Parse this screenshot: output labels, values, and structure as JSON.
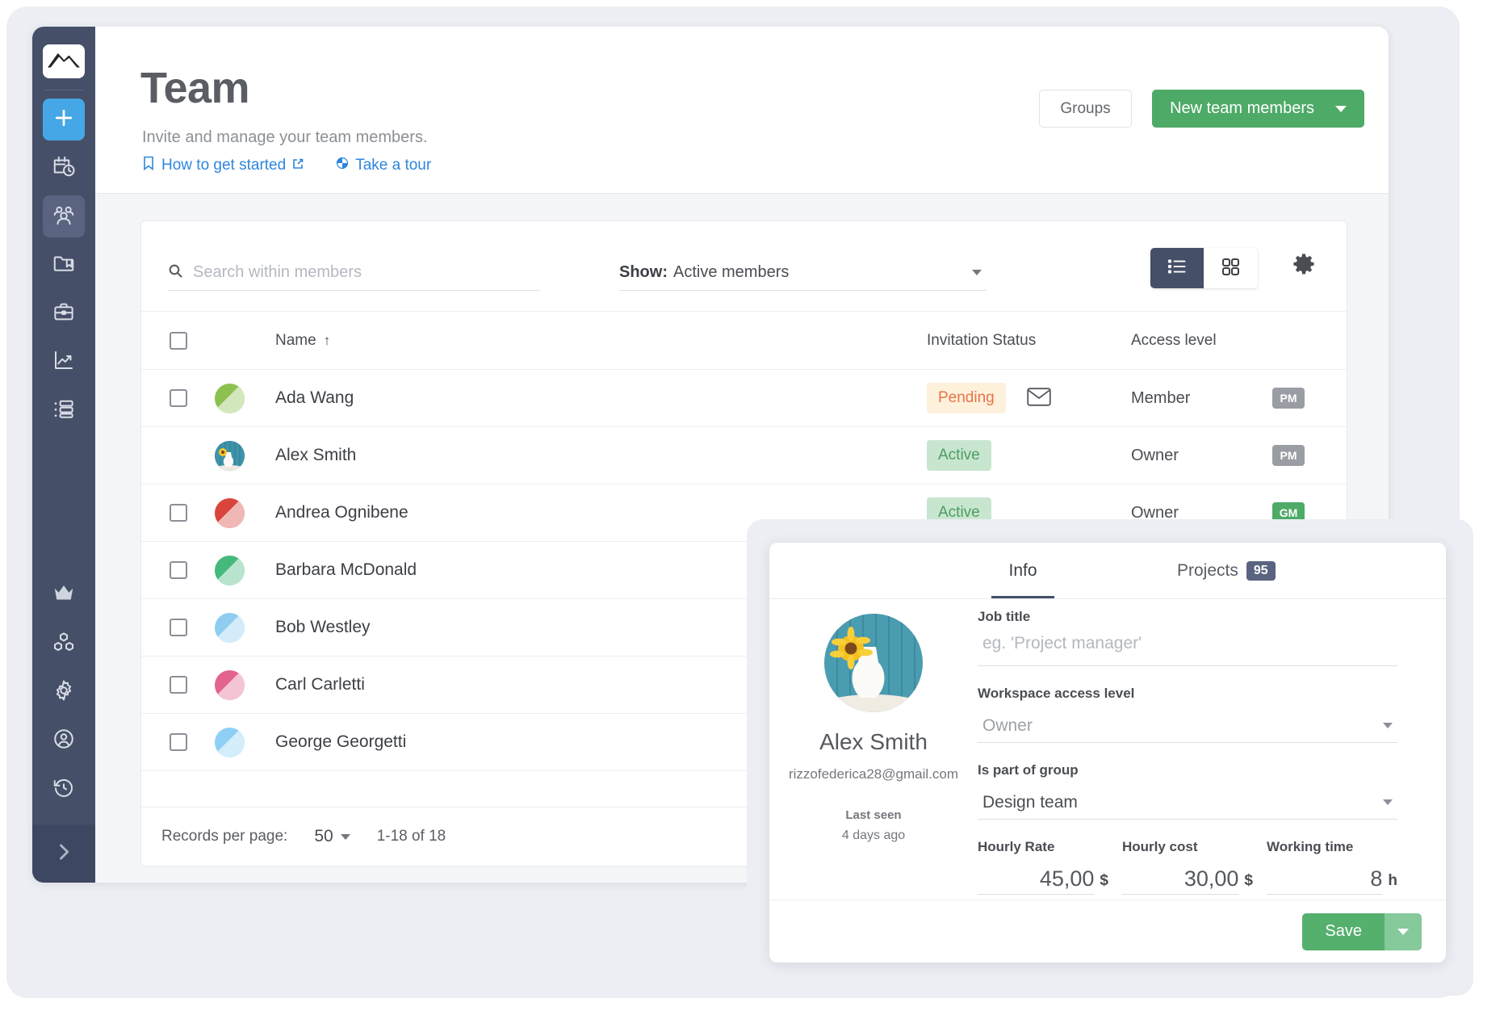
{
  "header": {
    "title": "Team",
    "subtitle": "Invite and manage your team members.",
    "links": [
      {
        "label": "How to get started",
        "icon": "bookmark-icon",
        "external": true
      },
      {
        "label": "Take a tour",
        "icon": "tour-icon",
        "external": false
      }
    ],
    "groups_button": "Groups",
    "new_members_button": "New team members"
  },
  "sidebar": {
    "items": [
      {
        "name": "logo",
        "icon": "mountain-logo-icon"
      },
      {
        "name": "add",
        "icon": "plus-icon"
      },
      {
        "name": "timesheet",
        "icon": "calendar-clock-icon"
      },
      {
        "name": "team",
        "icon": "people-icon"
      },
      {
        "name": "projects",
        "icon": "folder-bookmark-icon"
      },
      {
        "name": "clients",
        "icon": "briefcase-icon"
      },
      {
        "name": "reports",
        "icon": "chart-trend-icon"
      },
      {
        "name": "planner",
        "icon": "list-settings-icon"
      },
      {
        "name": "upgrade",
        "icon": "crown-icon"
      },
      {
        "name": "integrations",
        "icon": "cubes-icon"
      },
      {
        "name": "settings",
        "icon": "gear-icon"
      },
      {
        "name": "account",
        "icon": "user-circle-icon"
      },
      {
        "name": "history",
        "icon": "clock-rewind-icon"
      },
      {
        "name": "expand",
        "icon": "chevron-right-icon"
      }
    ]
  },
  "toolbar": {
    "search_placeholder": "Search within members",
    "search_value": "",
    "show_label": "Show:",
    "show_value": "Active members",
    "view_list_icon": "list-view-icon",
    "view_grid_icon": "grid-view-icon",
    "settings_icon": "gear-icon"
  },
  "table": {
    "columns": [
      "",
      "",
      "Name",
      "Invitation Status",
      "Access level",
      ""
    ],
    "sort_column": "Name",
    "sort_direction": "↑",
    "rows": [
      {
        "name": "Ada Wang",
        "checkbox": true,
        "status": "Pending",
        "status_kind": "pending",
        "mail_icon": true,
        "access": "Member",
        "role_badge": "PM",
        "role_kind": "pm",
        "avatar_color": "#8cc152",
        "avatar_kind": "color"
      },
      {
        "name": "Alex Smith",
        "checkbox": false,
        "status": "Active",
        "status_kind": "active",
        "mail_icon": false,
        "access": "Owner",
        "role_badge": "PM",
        "role_kind": "pm",
        "avatar_color": "#3d8fa6",
        "avatar_kind": "photo"
      },
      {
        "name": "Andrea Ognibene",
        "checkbox": true,
        "status": "Active",
        "status_kind": "active",
        "mail_icon": false,
        "access": "Owner",
        "role_badge": "GM",
        "role_kind": "gm",
        "avatar_color": "#d9453d",
        "avatar_kind": "color"
      },
      {
        "name": "Barbara McDonald",
        "checkbox": true,
        "status": "",
        "status_kind": "",
        "mail_icon": false,
        "access": "",
        "role_badge": "",
        "role_kind": "",
        "avatar_color": "#45b97c",
        "avatar_kind": "color"
      },
      {
        "name": "Bob Westley",
        "checkbox": true,
        "status": "",
        "status_kind": "",
        "mail_icon": false,
        "access": "",
        "role_badge": "",
        "role_kind": "",
        "avatar_color": "#8fcdf0",
        "avatar_kind": "color"
      },
      {
        "name": "Carl Carletti",
        "checkbox": true,
        "status": "",
        "status_kind": "",
        "mail_icon": false,
        "access": "",
        "role_badge": "",
        "role_kind": "",
        "avatar_color": "#e2638e",
        "avatar_kind": "color"
      },
      {
        "name": "George Georgetti",
        "checkbox": true,
        "status": "",
        "status_kind": "",
        "mail_icon": false,
        "access": "",
        "role_badge": "",
        "role_kind": "",
        "avatar_color": "#8ed0f5",
        "avatar_kind": "color"
      }
    ],
    "footer": {
      "records_label": "Records per page:",
      "records_value": "50",
      "range": "1-18 of 18"
    }
  },
  "detail": {
    "tabs": [
      {
        "label": "Info",
        "selected": true,
        "badge": ""
      },
      {
        "label": "Projects",
        "selected": false,
        "badge": "95"
      }
    ],
    "profile": {
      "name": "Alex Smith",
      "email": "rizzofederica28@gmail.com",
      "last_seen_label": "Last seen",
      "last_seen_value": "4 days ago",
      "avatar_icon": "sunflower-vase-photo"
    },
    "fields": {
      "job_title_label": "Job title",
      "job_title_placeholder": "eg. 'Project manager'",
      "job_title_value": "",
      "access_label": "Workspace access level",
      "access_value": "Owner",
      "group_label": "Is part of group",
      "group_value": "Design team",
      "hourly_rate_label": "Hourly Rate",
      "hourly_rate_value": "45,00",
      "hourly_rate_unit": "$",
      "hourly_cost_label": "Hourly cost",
      "hourly_cost_value": "30,00",
      "hourly_cost_unit": "$",
      "working_time_label": "Working time",
      "working_time_value": "8",
      "working_time_unit": "h"
    },
    "save_button": "Save"
  },
  "colors": {
    "brand_green": "#4eaa67",
    "sidebar": "#454f68",
    "accent_blue": "#45a7e5",
    "link_blue": "#2e86de",
    "pending_bg": "#fdf1dc",
    "pending_fg": "#e8734a",
    "active_bg": "#c8e6cf",
    "active_fg": "#4c9c62"
  }
}
